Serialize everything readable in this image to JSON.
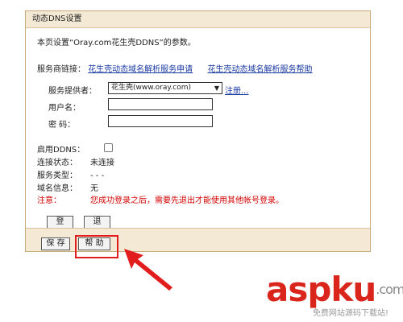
{
  "panel": {
    "title": "动态DNS设置",
    "intro": "本页设置“Oray.com花生壳DDNS”的参数。",
    "service_links": {
      "label": "服务商链接：",
      "link1": "花生壳动态域名解析服务申请",
      "link2": "花生壳动态域名解析服务帮助"
    },
    "form": {
      "provider_label": "服务提供者：",
      "provider_value": "花生壳(www.oray.com)",
      "register_link": "注册...",
      "username_label": "用户名：",
      "username_value": "",
      "password_label": "密 码：",
      "password_value": ""
    },
    "status": {
      "enable_label": "启用DDNS：",
      "enable_checked": false,
      "conn_label": "连接状态：",
      "conn_value": "未连接",
      "type_label": "服务类型：",
      "type_value": "- - -",
      "domain_label": "域名信息：",
      "domain_value": "无",
      "note_label": "注意：",
      "note_value": "您成功登录之后，需要先退出才能使用其他帐号登录。"
    },
    "buttons": {
      "login": "登 录",
      "logout": "退 出",
      "save": "保 存",
      "help": "帮 助"
    }
  },
  "watermark": {
    "main": "aspku",
    "suffix": ".com",
    "sub": "免费网站源码下载站!"
  },
  "colors": {
    "highlight": "#e21d1d",
    "title_bar": "#f4e9d4",
    "link": "#1a3aa3",
    "note": "#d00000"
  }
}
